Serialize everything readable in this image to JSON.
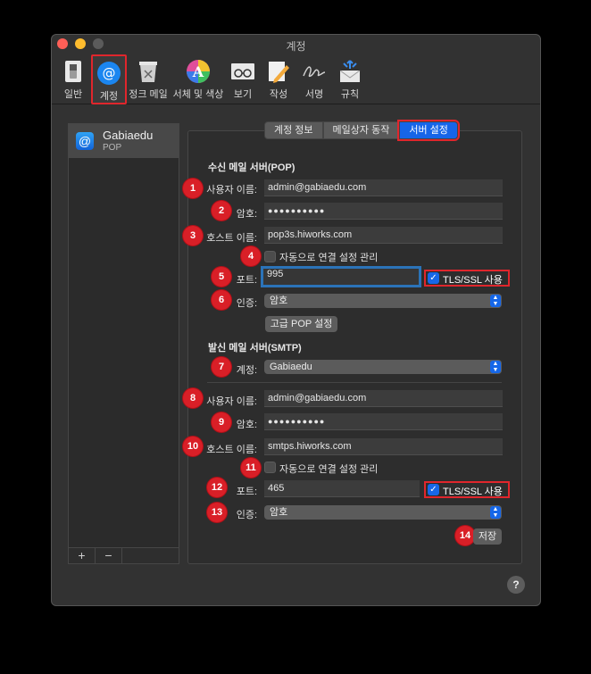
{
  "window": {
    "title": "계정"
  },
  "toolbar": {
    "items": [
      {
        "label": "일반",
        "icon": "general-switch-icon"
      },
      {
        "label": "계정",
        "icon": "at-sign-icon"
      },
      {
        "label": "정크 메일",
        "icon": "trash-bin-icon"
      },
      {
        "label": "서체 및 색상",
        "icon": "color-font-icon"
      },
      {
        "label": "보기",
        "icon": "glasses-icon"
      },
      {
        "label": "작성",
        "icon": "pencil-icon"
      },
      {
        "label": "서명",
        "icon": "signature-icon"
      },
      {
        "label": "규칙",
        "icon": "envelope-rules-icon"
      }
    ]
  },
  "sidebar": {
    "account_name": "Gabiaedu",
    "account_type": "POP",
    "add_label": "+",
    "remove_label": "−"
  },
  "tabs": [
    {
      "label": "계정 정보"
    },
    {
      "label": "메일상자 동작"
    },
    {
      "label": "서버 설정"
    }
  ],
  "incoming": {
    "title": "수신 메일 서버(POP)",
    "username_label": "사용자 이름:",
    "username": "admin@gabiaedu.com",
    "password_label": "암호:",
    "password": "●●●●●●●●●●",
    "host_label": "호스트 이름:",
    "host": "pop3s.hiworks.com",
    "auto_manage_label": "자동으로 연결 설정 관리",
    "port_label": "포트:",
    "port": "995",
    "tls_label": "TLS/SSL 사용",
    "auth_label": "인증:",
    "auth": "암호",
    "advanced_button": "고급 POP 설정"
  },
  "outgoing": {
    "title": "발신 메일 서버(SMTP)",
    "account_label": "계정:",
    "account": "Gabiaedu",
    "username_label": "사용자 이름:",
    "username": "admin@gabiaedu.com",
    "password_label": "암호:",
    "password": "●●●●●●●●●●",
    "host_label": "호스트 이름:",
    "host": "smtps.hiworks.com",
    "auto_manage_label": "자동으로 연결 설정 관리",
    "port_label": "포트:",
    "port": "465",
    "tls_label": "TLS/SSL 사용",
    "auth_label": "인증:",
    "auth": "암호",
    "save_button": "저장"
  },
  "badges": [
    "1",
    "2",
    "3",
    "4",
    "5",
    "6",
    "7",
    "8",
    "9",
    "10",
    "11",
    "12",
    "13",
    "14"
  ],
  "help": "?",
  "colors": {
    "accent": "#1665e8",
    "highlight": "#e0262c",
    "badge": "#d91f27"
  }
}
